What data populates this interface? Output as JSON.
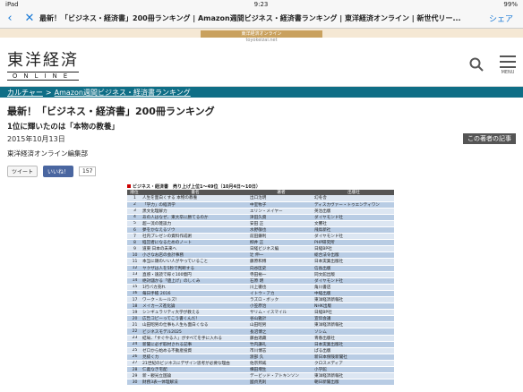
{
  "status": {
    "device": "iPad",
    "time": "9:23",
    "battery": "99%"
  },
  "nav": {
    "page_title": "最新！「ビジネス・経済書」200冊ランキング | Amazon週間ビジネス・経済書ランキング | 東洋経済オンライン | 新世代リー...",
    "share_label": "シェア"
  },
  "banner": {
    "bar_text": "東洋経済オンライン",
    "url": "toyokeizai.net"
  },
  "logo": {
    "main": "東洋経済",
    "sub": "ONLINE"
  },
  "menu": {
    "label": "MENU"
  },
  "breadcrumb": {
    "items": [
      "カルチャー",
      "Amazon週間ビジネス・経済書ランキング"
    ],
    "separator": ">"
  },
  "article": {
    "title": "最新！「ビジネス・経済書」200冊ランキング",
    "subtitle": "1位に輝いたのは「本物の教養」",
    "date": "2015年10月13日",
    "author_button": "この著者の記事",
    "author": "東洋経済オンライン編集部"
  },
  "social": {
    "tweet": "ツイート",
    "like": "いいね！",
    "count": "157"
  },
  "table": {
    "title": "ビジネス・経済書　売り上げ上位1〜49位（10月4日〜10日）",
    "headers": [
      "順位",
      "書名",
      "著者",
      "出版社"
    ],
    "rows": [
      [
        "1",
        "人生を面白くする 本物の教養",
        "出口治明",
        "幻冬舎"
      ],
      [
        "2",
        "「学力」の経済学",
        "中室牧子",
        "ディスカヴァー・トゥエンティワン"
      ],
      [
        "3",
        "黒文化理解力",
        "エリン・メイヤー",
        "英治出版"
      ],
      [
        "4",
        "あの人はなぜ、東大卒に勝てるのか",
        "津田久資",
        "ダイヤモンド社"
      ],
      [
        "5",
        "超一流の雑談力",
        "安田 正",
        "文響社"
      ],
      [
        "6",
        "夢をかなえるゾウ",
        "水野敬也",
        "飛鳥新社"
      ],
      [
        "7",
        "社内プレゼンの資料作成術",
        "前田鎌利",
        "ダイヤモンド社"
      ],
      [
        "8",
        "経営者になるためのノート",
        "柳井 正",
        "PHP研究所"
      ],
      [
        "9",
        "道東 日本の未来へ",
        "日経ビジネス編",
        "日経BP社"
      ],
      [
        "10",
        "小さなお店の会計事務",
        "辻 伸一",
        "総合法令出版"
      ],
      [
        "11",
        "本当に頭のいい人がやっていること",
        "藤原和博",
        "日本実業出版社"
      ],
      [
        "12",
        "ヤクザは人を5秒で判断する",
        "向谷匡史",
        "信長出版"
      ],
      [
        "13",
        "直感・速読で稼ぐ100億円",
        "寺田裕一",
        "同文館出版"
      ],
      [
        "14",
        "絶対儲かる「値上げ」のしくみ",
        "石原 明",
        "ダイヤモンド社"
      ],
      [
        "15",
        "1行バカ売れ",
        "川上徹也",
        "角川書店"
      ],
      [
        "16",
        "毎日手帳 2016",
        "イトウ・アカ",
        "中経出版"
      ],
      [
        "17",
        "ワーク・ルールズ！",
        "ラズロ・ボック",
        "東洋経済新報社"
      ],
      [
        "18",
        "メイカーズ進化論",
        "小笠原治",
        "NHK出版"
      ],
      [
        "19",
        "シンギュラリティ大学が教える",
        "サリム・イスマイル",
        "日経BP社"
      ],
      [
        "20",
        "広告コピーってこう書くんだ！",
        "谷山雅計",
        "宣伝会議"
      ],
      [
        "21",
        "山田昭男の仕事も人生も面白くなる",
        "山田昭男",
        "東洋経済新報社"
      ],
      [
        "22",
        "ビジネスモデル2025",
        "長沼博之",
        "ソシム"
      ],
      [
        "23",
        "結局、「すぐやる人」がすべてを手に入れる",
        "藤由達藏",
        "青春出版社"
      ],
      [
        "24",
        "新聞に必ず取材される記事",
        "竹内謙礼",
        "日本実業出版社"
      ],
      [
        "25",
        "ゼロから始める不動産投資",
        "市川博志",
        "ぱる出版"
      ],
      [
        "26",
        "見抜くカ",
        "渡部 久",
        "新日本保険新聞社"
      ],
      [
        "27",
        "21世紀のビジネスにデザイン思考が必要な理由",
        "佐宗邦威",
        "クロスメディア"
      ],
      [
        "28",
        "仁義なき宅配",
        "横田増生",
        "小学館"
      ],
      [
        "29",
        "新・観光立国論",
        "デービッド・アトキンソン",
        "東洋経済新報社"
      ],
      [
        "30",
        "財務3表一体理解法",
        "國貞克則",
        "朝日新聞出版"
      ]
    ]
  }
}
